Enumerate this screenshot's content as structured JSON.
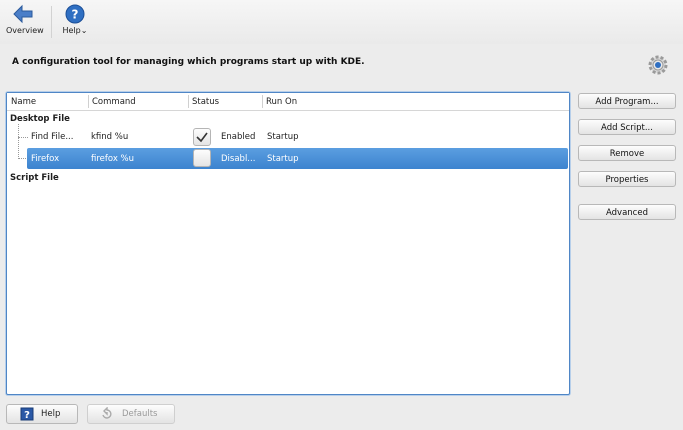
{
  "toolbar": {
    "overview_label": "Overview",
    "help_label": "Help"
  },
  "description": "A configuration tool for managing which programs start up with KDE.",
  "columns": {
    "name": "Name",
    "command": "Command",
    "status": "Status",
    "run_on": "Run On"
  },
  "groups": {
    "desktop_file": "Desktop File",
    "script_file": "Script File"
  },
  "rows": [
    {
      "name": "Find File...",
      "command": "kfind %u",
      "checked": true,
      "status": "Enabled",
      "run_on": "Startup"
    },
    {
      "name": "Firefox",
      "command": "firefox %u",
      "checked": false,
      "status": "Disabl...",
      "run_on": "Startup"
    }
  ],
  "buttons": {
    "add_program": "Add Program...",
    "add_script": "Add Script...",
    "remove": "Remove",
    "properties": "Properties",
    "advanced": "Advanced"
  },
  "bottom": {
    "help": "Help",
    "defaults": "Defaults"
  },
  "colors": {
    "selection": "#3c83cf",
    "accent_blue": "#2f6fc2"
  },
  "icons": {
    "overview": "back-arrow-icon",
    "help": "help-circle-icon",
    "configure": "gear-icon"
  }
}
